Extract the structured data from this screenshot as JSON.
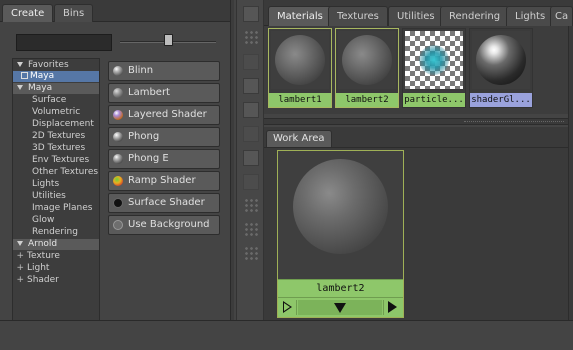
{
  "left_panel": {
    "tabs": [
      "Create",
      "Bins"
    ],
    "active_tab": "Create",
    "filter": {
      "value": ""
    },
    "tree": {
      "favorites": {
        "label": "Favorites",
        "items": [
          "Maya"
        ]
      },
      "maya": {
        "label": "Maya",
        "items": [
          "Surface",
          "Volumetric",
          "Displacement",
          "2D Textures",
          "3D Textures",
          "Env Textures",
          "Other Textures",
          "Lights",
          "Utilities",
          "Image Planes",
          "Glow",
          "Rendering"
        ]
      },
      "arnold": {
        "label": "Arnold",
        "items": [
          "Texture",
          "Light",
          "Shader"
        ]
      }
    },
    "shaders": [
      "Blinn",
      "Lambert",
      "Layered Shader",
      "Phong",
      "Phong E",
      "Ramp Shader",
      "Surface Shader",
      "Use Background"
    ]
  },
  "hypershade": {
    "tabs": [
      "Materials",
      "Textures",
      "Utilities",
      "Rendering",
      "Lights",
      "Ca"
    ],
    "active_tab": "Materials",
    "swatches": [
      "lambert1",
      "lambert2",
      "particle...",
      "shaderGl..."
    ],
    "work_area": {
      "tab": "Work Area",
      "node": {
        "label": "lambert2"
      }
    }
  },
  "colors": {
    "selection": "#5677a6",
    "node_label_green": "#8ec76a",
    "node_label_purple": "#9aa2dc",
    "node_border": "#9fb056"
  },
  "icons": {
    "port_input": "outline-play-icon",
    "port_expand": "down-triangle-icon",
    "port_output": "play-icon"
  }
}
